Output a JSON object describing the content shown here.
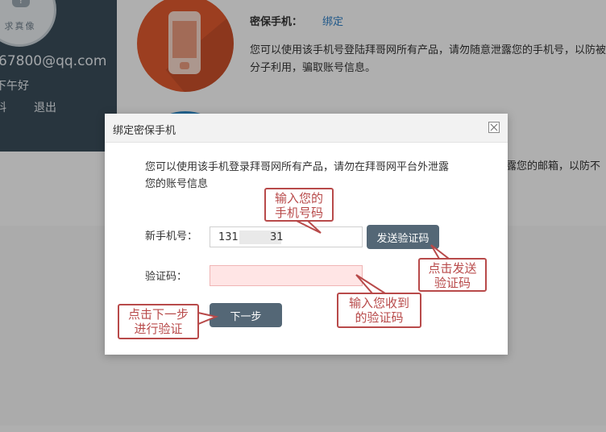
{
  "background": {
    "sidebar": {
      "avatar_label": "求真像",
      "avatar_glyph": "?",
      "email": "67800@qq.com",
      "greeting": "下午好",
      "profile_label": "料",
      "logout_label": "退出"
    },
    "security": {
      "phone_title": "密保手机：",
      "phone_link": "绑定",
      "phone_desc": "您可以使用该手机号登陆拜哥网所有产品，请勿随意泄露您的手机号，以防被不法分子利用，骗取账号信息。",
      "email_desc_tail": "露您的邮箱，以防不"
    }
  },
  "dialog": {
    "title": "绑定密保手机",
    "description": "您可以使用该手机登录拜哥网所有产品，请勿在拜哥网平台外泄露您的账号信息",
    "phone_label": "新手机号：",
    "phone_value_prefix": "131",
    "phone_value_suffix": "31",
    "send_code_label": "发送验证码",
    "code_label": "验证码：",
    "code_value": "",
    "next_label": "下一步"
  },
  "annotations": {
    "phone_hint": [
      "输入您的",
      "手机号码"
    ],
    "send_hint": [
      "点击发送",
      "验证码"
    ],
    "code_hint": [
      "输入您收到",
      "的验证码"
    ],
    "next_hint": [
      "点击下一步",
      "进行验证"
    ]
  },
  "colors": {
    "sidebar": "#3a4d5a",
    "button": "#546776",
    "annotation": "#b84a4a",
    "link": "#2f7fc4",
    "phone_circle": "#e0592f",
    "mail_circle": "#2f8fcf",
    "code_input_bg": "#ffe5e5"
  }
}
